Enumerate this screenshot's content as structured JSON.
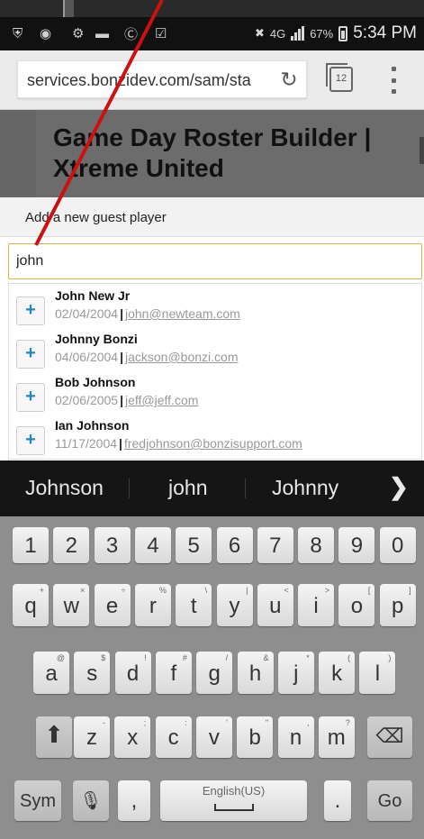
{
  "status_bar": {
    "time": "5:34 PM",
    "battery_percent": "67%",
    "network": "4G"
  },
  "browser": {
    "url": "services.bonzidev.com/sam/sta",
    "tab_count": "12"
  },
  "app": {
    "title": "Game Day Roster Builder | Xtreme United"
  },
  "guest": {
    "label": "Add a new guest player",
    "search_value": "john",
    "results": [
      {
        "name": "John New Jr",
        "date": "02/04/2004",
        "email": "john@newteam.com",
        "add_label": "+"
      },
      {
        "name": "Johnny Bonzi",
        "date": "04/06/2004",
        "email": "jackson@bonzi.com",
        "add_label": "+"
      },
      {
        "name": "Bob Johnson",
        "date": "02/06/2005",
        "email": "jeff@jeff.com",
        "add_label": "+"
      },
      {
        "name": "Ian Johnson",
        "date": "11/17/2004",
        "email": "fredjohnson@bonzisupport.com",
        "add_label": "+"
      }
    ],
    "separator": "|"
  },
  "keyboard": {
    "suggestions": [
      "Johnson",
      "john",
      "Johnny"
    ],
    "numbers": [
      "1",
      "2",
      "3",
      "4",
      "5",
      "6",
      "7",
      "8",
      "9",
      "0"
    ],
    "row1": [
      {
        "k": "q",
        "s": "+"
      },
      {
        "k": "w",
        "s": "×"
      },
      {
        "k": "e",
        "s": "÷"
      },
      {
        "k": "r",
        "s": "%"
      },
      {
        "k": "t",
        "s": "\\"
      },
      {
        "k": "y",
        "s": "|"
      },
      {
        "k": "u",
        "s": "<"
      },
      {
        "k": "i",
        "s": ">"
      },
      {
        "k": "o",
        "s": "["
      },
      {
        "k": "p",
        "s": "]"
      }
    ],
    "row2": [
      {
        "k": "a",
        "s": "@"
      },
      {
        "k": "s",
        "s": "$"
      },
      {
        "k": "d",
        "s": "!"
      },
      {
        "k": "f",
        "s": "#"
      },
      {
        "k": "g",
        "s": "/"
      },
      {
        "k": "h",
        "s": "&"
      },
      {
        "k": "j",
        "s": "*"
      },
      {
        "k": "k",
        "s": "("
      },
      {
        "k": "l",
        "s": ")"
      }
    ],
    "row3": [
      {
        "k": "z",
        "s": "-"
      },
      {
        "k": "x",
        "s": ";"
      },
      {
        "k": "c",
        "s": ":"
      },
      {
        "k": "v",
        "s": "'"
      },
      {
        "k": "b",
        "s": "\""
      },
      {
        "k": "n",
        "s": ","
      },
      {
        "k": "m",
        "s": "?"
      }
    ],
    "sym_label": "Sym",
    "comma": ",",
    "space_label": "English(US)",
    "period": ".",
    "go_label": "Go"
  }
}
